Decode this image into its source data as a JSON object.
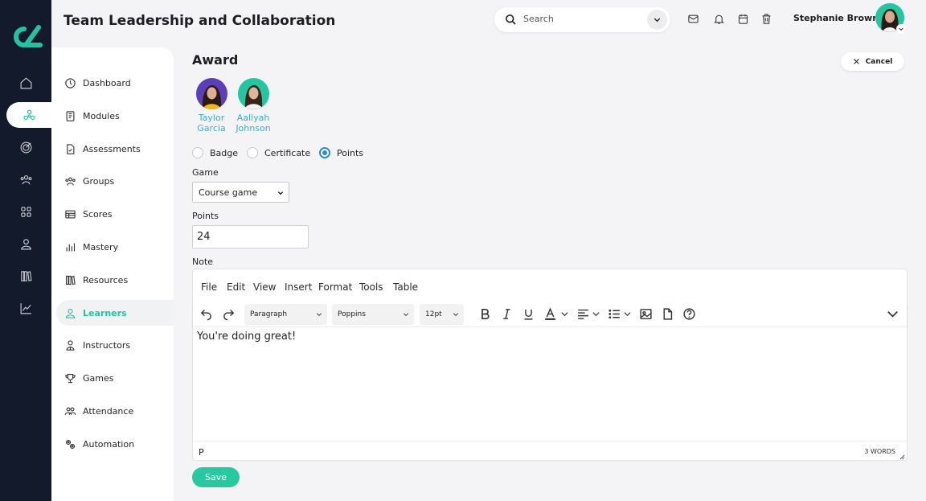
{
  "app": {
    "brand_color": "#23c3a0",
    "rail_color": "#131a2c"
  },
  "header": {
    "title": "Team Leadership and Collaboration",
    "search_placeholder": "Search",
    "user_name": "Stephanie Brown",
    "icons": [
      "mail-icon",
      "bell-icon",
      "calendar-icon",
      "trash-icon"
    ]
  },
  "rail": {
    "items": [
      "home-icon",
      "modules-hub-icon",
      "target-icon",
      "people-icon",
      "grid-icon",
      "user-icon",
      "library-icon",
      "chart-icon"
    ],
    "active_index": 1
  },
  "sidebar": {
    "items": [
      {
        "label": "Dashboard",
        "icon": "dashboard-icon"
      },
      {
        "label": "Modules",
        "icon": "book-icon"
      },
      {
        "label": "Assessments",
        "icon": "assessment-icon"
      },
      {
        "label": "Groups",
        "icon": "groups-icon"
      },
      {
        "label": "Scores",
        "icon": "table-icon"
      },
      {
        "label": "Mastery",
        "icon": "bars-icon"
      },
      {
        "label": "Resources",
        "icon": "library-icon"
      },
      {
        "label": "Learners",
        "icon": "learner-icon"
      },
      {
        "label": "Instructors",
        "icon": "instructor-icon"
      },
      {
        "label": "Games",
        "icon": "trophy-icon"
      },
      {
        "label": "Attendance",
        "icon": "attendance-icon"
      },
      {
        "label": "Automation",
        "icon": "gears-icon"
      }
    ],
    "active_index": 7
  },
  "award": {
    "title": "Award",
    "cancel_label": "Cancel",
    "recipients": [
      {
        "first": "Taylor",
        "last": "Garcia"
      },
      {
        "first": "Aaliyah",
        "last": "Johnson"
      }
    ],
    "types": [
      "Badge",
      "Certificate",
      "Points"
    ],
    "selected_type": "Points",
    "game_label": "Game",
    "game_value": "Course game",
    "points_label": "Points",
    "points_value": "24",
    "note_label": "Note",
    "save_label": "Save"
  },
  "editor": {
    "menus": [
      "File",
      "Edit",
      "View",
      "Insert",
      "Format",
      "Tools",
      "Table"
    ],
    "block_format": "Paragraph",
    "font_family": "Poppins",
    "font_size": "12pt",
    "content": "You're doing great!",
    "path": "P",
    "word_count": "3 WORDS"
  }
}
